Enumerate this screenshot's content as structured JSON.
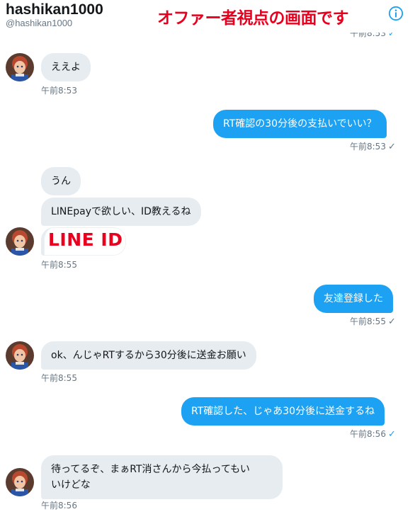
{
  "header": {
    "name": "hashikan1000",
    "handle": "@hashikan1000",
    "overlay_caption": "オファー者視点の画面です",
    "peek_time": "午前8:53"
  },
  "overlays": {
    "line_id": "LINE ID"
  },
  "messages": [
    {
      "side": "received",
      "text": "ええよ",
      "time": "午前8:53"
    },
    {
      "side": "sent",
      "text": "RT確認の30分後の支払いでいい？",
      "time": "午前8:53"
    },
    {
      "side": "received",
      "text": "うん"
    },
    {
      "side": "received",
      "text": "LINEpayで欲しい、ID教えるね",
      "time": "午前8:55"
    },
    {
      "side": "sent",
      "text": "友達登録した",
      "time": "午前8:55"
    },
    {
      "side": "received",
      "text": "ok、んじゃRTするから30分後に送金お願い",
      "time": "午前8:55"
    },
    {
      "side": "sent",
      "text": "RT確認した、じゃあ30分後に送金するね",
      "time": "午前8:56"
    },
    {
      "side": "received",
      "text_line1": "待ってるぞ、まぁRT消さんから今払ってもい",
      "text_line2": "いけどな",
      "time": "午前8:56"
    }
  ],
  "colors": {
    "sent_bubble": "#1da1f2",
    "received_bubble": "#e6ecf0",
    "overlay_red": "#e8001e",
    "timestamp": "#657786"
  },
  "icons": {
    "info": "info-icon",
    "read_receipt": "checkmark-icon"
  }
}
